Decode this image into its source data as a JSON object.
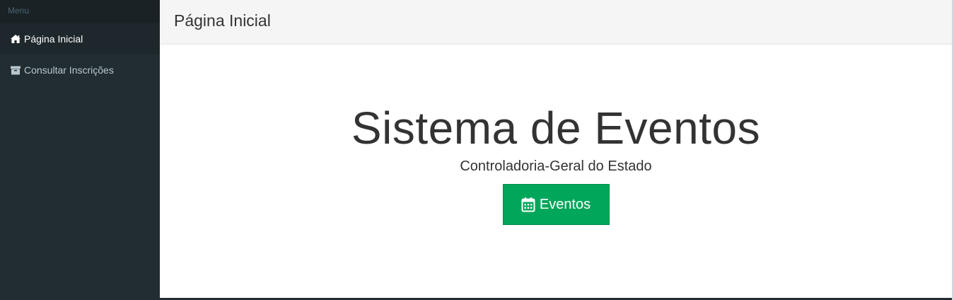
{
  "sidebar": {
    "header": "Menu",
    "items": [
      {
        "label": "Página Inicial",
        "icon": "home-icon",
        "active": true
      },
      {
        "label": "Consultar Inscrições",
        "icon": "archive-icon",
        "active": false
      }
    ]
  },
  "header": {
    "title": "Página Inicial"
  },
  "hero": {
    "title": "Sistema de Eventos",
    "subtitle": "Controladoria-Geral do Estado",
    "button_label": "Eventos",
    "button_icon": "calendar-icon"
  },
  "colors": {
    "sidebar_bg": "#222d32",
    "button_green": "#00a65a",
    "header_bg": "#f4f5f4"
  }
}
